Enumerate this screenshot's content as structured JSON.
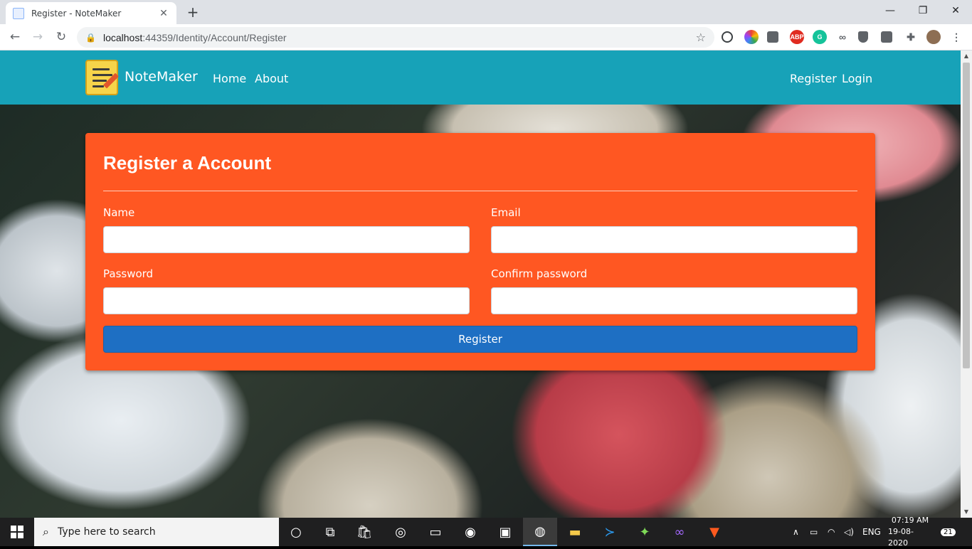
{
  "browser": {
    "tab_title": "Register - NoteMaker",
    "tab_close": "✕",
    "new_tab": "+",
    "url_host": "localhost",
    "url_rest": ":44359/Identity/Account/Register",
    "window_controls": [
      "—",
      "❐",
      "✕"
    ],
    "extensions": [
      "ABP"
    ]
  },
  "navbar": {
    "brand": "NoteMaker",
    "links": [
      "Home",
      "About"
    ],
    "right_links": [
      "Register",
      "Login"
    ],
    "color": "#17a2b8"
  },
  "form": {
    "title": "Register a Account",
    "fields": [
      {
        "label": "Name",
        "value": ""
      },
      {
        "label": "Email",
        "value": ""
      },
      {
        "label": "Password",
        "value": ""
      },
      {
        "label": "Confirm password",
        "value": ""
      }
    ],
    "submit": "Register",
    "card_color": "#ff5722",
    "button_color": "#1e6fc3"
  },
  "taskbar": {
    "search_placeholder": "Type here to search",
    "language": "ENG",
    "time": "07:19 AM",
    "date": "19-08-2020",
    "notification_count": "21"
  }
}
